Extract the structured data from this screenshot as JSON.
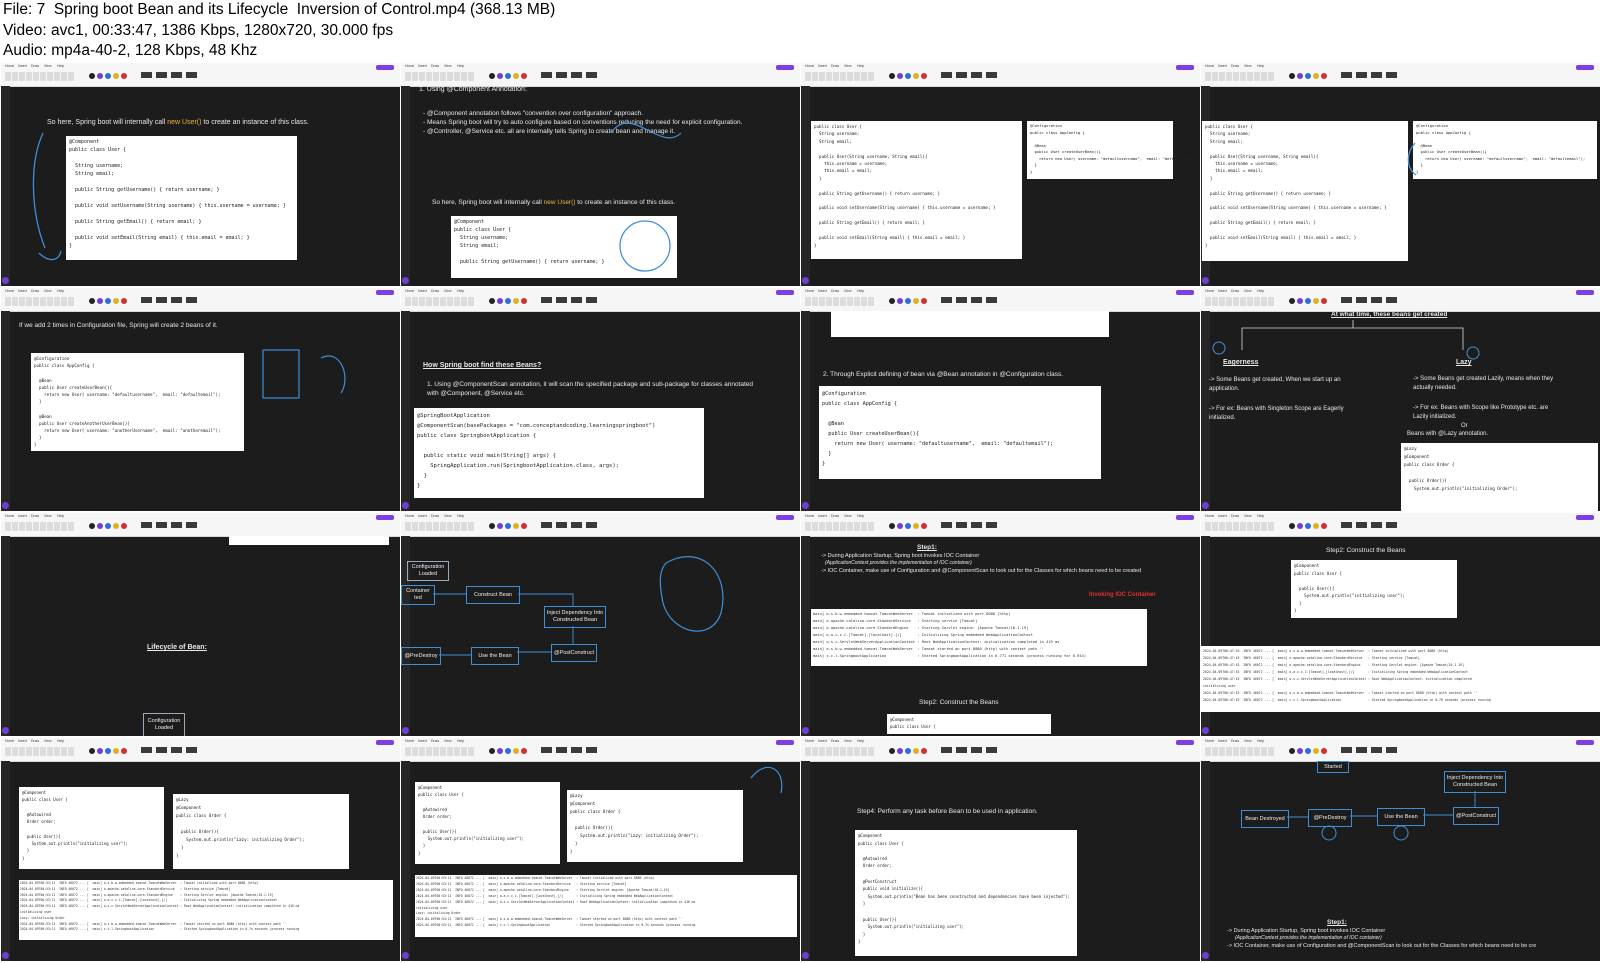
{
  "header": {
    "file_line": "File: 7  Spring boot Bean and its Lifecycle  Inversion of Control.mp4 (368.13 MB)",
    "video_line": "Video: avc1, 00:33:47, 1386 Kbps, 1280x720, 30.000 fps",
    "audio_line": "Audio: mp4a-40-2, 128 Kbps, 48 Khz"
  },
  "toolbar": {
    "menus": [
      "Home",
      "Insert",
      "Draw",
      "View",
      "Help"
    ],
    "share": "Share"
  },
  "colors": {
    "accent": "#7b3fe4",
    "ink": "#3f8fd8",
    "annotation": "#f0b341",
    "background": "#1c1c1c"
  },
  "frames": {
    "f1": {
      "text_pre": "So here, Spring boot will internally call ",
      "text_hl": "new User()",
      "text_post": " to create an instance of this class.",
      "code": [
        "@Component",
        "public class User {",
        "",
        "  String username;",
        "  String email;",
        "",
        "  public String getUsername() { return username; }",
        "",
        "  public void setUsername(String username) { this.username = username; }",
        "",
        "  public String getEmail() { return email; }",
        "",
        "  public void setEmail(String email) { this.email = email; }",
        "}"
      ]
    },
    "f2": {
      "heading": "1.  Using @Component Annotation:",
      "bullets": [
        "@Component annotation follows \"convention over configuration\" approach.",
        "Means Spring boot will try to auto configure based on conventions reducing the need for explicit configuration.",
        "@Controller, @Service etc. all are internally tells Spring to create bean and manage it."
      ],
      "text_pre": "So here, Spring boot will internally call ",
      "text_hl": "new User()",
      "text_post": " to create an instance of this class.",
      "code": [
        "@Component",
        "public class User {",
        "  String username;",
        "  String email;",
        "",
        "  public String getUsername() { return username; }"
      ]
    },
    "f3": {
      "code_left": [
        "public class User {",
        "  String username;",
        "  String email;",
        "",
        "  public User(String username, String email){",
        "    this.username = username;",
        "    this.email = email;",
        "  }",
        "",
        "  public String getUsername() { return username; }",
        "",
        "  public void setUsername(String username) { this.username = username; }",
        "",
        "  public String getEmail() { return email; }",
        "",
        "  public void setEmail(String email) { this.email = email; }",
        "}"
      ],
      "code_right": [
        "@Configuration",
        "public class AppConfig {",
        "",
        "  @Bean",
        "  public User createUserBean(){",
        "    return new User( username: \"defaultusername\",  email: \"defaultemail\");",
        "  }",
        "}"
      ]
    },
    "f4": {
      "code_left": [
        "public class User {",
        "  String username;",
        "  String email;",
        "",
        "  public User(String username, String email){",
        "    this.username = username;",
        "    this.email = email;",
        "  }",
        "",
        "  public String getUsername() { return username; }",
        "",
        "  public void setUsername(String username) { this.username = username; }",
        "",
        "  public String getEmail() { return email; }",
        "",
        "  public void setEmail(String email) { this.email = email; }",
        "}"
      ],
      "code_right": [
        "@Configuration",
        "public class AppConfig {",
        "",
        "  @Bean",
        "  public User createUserBean(){",
        "    return new User( username: \"defaultusername\",  email: \"defaultemail\");",
        "  }",
        "}"
      ]
    },
    "f5": {
      "text": "If we add 2 times in Configuration file, Spring will create 2 beans of it.",
      "code": [
        "@Configuration",
        "public class AppConfig {",
        "",
        "  @Bean",
        "  public User createUserBean(){",
        "    return new User( username: \"defaultusername\",  email: \"defaultemail\");",
        "  }",
        "",
        "  @Bean",
        "  public User createAnotherUserBean(){",
        "    return new User( username: \"anotherUsername\",  email: \"anotheremail\");",
        "  }",
        "}"
      ]
    },
    "f6": {
      "heading": "How Spring boot find these Beans?",
      "item": "1.  Using @ComponentScan annotation, it will scan the specified package and sub-package for classes annotated with @Component, @Service etc.",
      "code": [
        "@SpringBootApplication",
        "@ComponentScan(basePackages = \"com.conceptandcoding.learningspringboot\")",
        "public class SpringbootApplication {",
        "",
        "  public static void main(String[] args) {",
        "    SpringApplication.run(SpringbootApplication.class, args);",
        "  }",
        "}"
      ]
    },
    "f7": {
      "item": "2.  Through Explicit defining of bean via @Bean annotation in @Configuration class.",
      "code": [
        "@Configuration",
        "public class AppConfig {",
        "",
        "  @Bean",
        "  public User createUserBean(){",
        "    return new User( username: \"defaultusername\",  email: \"defaultemail\");",
        "  }",
        "}"
      ]
    },
    "f8": {
      "heading": "At what time, these beans get created",
      "left_title": "Eagerness",
      "left_l1": "-> Some Beans get created, When we start up an application.",
      "left_l2": "-> For ex: Beans with Singleton Scope are Eagerly initialized.",
      "right_title": "Lazy",
      "right_l1": "-> Some Beans get created Lazily, means when they actually needed.",
      "right_l2": "-> For ex: Beans with Scope like Prototype etc. are Lazily initialized.",
      "right_or": "Or",
      "right_l3": "Beans with @Lazy annotation.",
      "code": [
        "@Lazy",
        "@Component",
        "public class Order {",
        "",
        "  public Order(){",
        "    System.out.println(\"initializing Order\");"
      ]
    },
    "f9": {
      "title": "Lifecycle of  Bean:",
      "box": "Configuration Loaded"
    },
    "f10": {
      "boxes": [
        "Configuration Loaded",
        "Container ted",
        "Construct Bean",
        "Inject Dependency Into Constructed Bean",
        "@PostConstruct",
        "Use the Bean",
        "@PreDestroy"
      ]
    },
    "f11": {
      "step1": "Step1:",
      "l1": "-> During Application Startup, Spring boot invokes IOC Container",
      "l2": "(ApplicationContext provides the implementation of IOC container)",
      "l3": "-> IOC Container, make use of Configuration and @ComponentScan to look out for the Classes for which beans need to be created",
      "annotation": "Invoking IOC Container",
      "log": [
        "main] o.s.b.w.embedded.tomcat.TomcatWebServer  : Tomcat initialized with port 8080 (http)",
        "main] o.apache.catalina.core.StandardService   : Starting service [Tomcat]",
        "main] o.apache.catalina.core.StandardEngine    : Starting Servlet engine: [Apache Tomcat/10.1.19]",
        "main] o.a.c.c.C.[Tomcat].[localhost].[/]       : Initializing Spring embedded WebApplicationContext",
        "main] w.s.c.ServletWebServerApplicationContext : Root WebApplicationContext: initialization completed in 419 ms",
        "main] o.s.b.w.embedded.tomcat.TomcatWebServer  : Tomcat started on port 8080 (http) with context path ''",
        "main] c.c.l.SpringbootApplication              : Started SpringbootApplication in 0.771 seconds (process running for 0.944)"
      ],
      "step2": "Step2:  Construct the Beans",
      "code": [
        "@Component",
        "public class User {"
      ]
    },
    "f12": {
      "step2": "Step2:  Construct the Beans",
      "code": [
        "@Component",
        "public class User {",
        "",
        "  public User(){",
        "    System.out.println(\"initializing user\");",
        "  }",
        "}"
      ],
      "log": [
        "2024-04-09T00:47:43  INFO 46072 --- [  main] o.s.b.w.embedded.tomcat.TomcatWebServer  : Tomcat initialized with port 8080 (http)",
        "2024-04-09T00:47:43  INFO 46072 --- [  main] o.apache.catalina.core.StandardService   : Starting service [Tomcat]",
        "2024-04-09T00:47:43  INFO 46072 --- [  main] o.apache.catalina.core.StandardEngine    : Starting Servlet engine: [Apache Tomcat/10.1.19]",
        "2024-04-09T00:47:43  INFO 46072 --- [  main] o.a.c.c.C.[Tomcat].[localhost].[/]       : Initializing Spring embedded WebApplicationContext",
        "2024-04-09T00:47:43  INFO 46072 --- [  main] w.s.c.ServletWebServerApplicationContext : Root WebApplicationContext: initialization completed",
        "initializing user",
        "2024-04-09T00:47:43  INFO 46072 --- [  main] o.s.b.w.embedded.tomcat.TomcatWebServer  : Tomcat started on port 8080 (http) with context path ''",
        "2024-04-09T00:47:43  INFO 46072 --- [  main] c.c.l.SpringbootApplication              : Started SpringbootApplication in 0.78 seconds (process running"
      ]
    },
    "f13": {
      "code_left": [
        "@Component",
        "public class User {",
        "",
        "  @Autowired",
        "  Order order;",
        "",
        "  public User(){",
        "    System.out.println(\"initializing user\");",
        "  }",
        "}"
      ],
      "code_right": [
        "@Lazy",
        "@Component",
        "public class Order {",
        "",
        "  public Order(){",
        "    System.out.println(\"Lazy: initializing Order\");",
        "  }",
        "}"
      ],
      "log": [
        "2024-04-09T00:53:11  INFO 46072 --- [  main] o.s.b.w.embedded.tomcat.TomcatWebServer  : Tomcat initialized with port 8080 (http)",
        "2024-04-09T00:53:11  INFO 46072 --- [  main] o.apache.catalina.core.StandardService   : Starting service [Tomcat]",
        "2024-04-09T00:53:11  INFO 46072 --- [  main] o.apache.catalina.core.StandardEngine    : Starting Servlet engine: [Apache Tomcat/10.1.19]",
        "2024-04-09T00:53:11  INFO 46072 --- [  main] o.a.c.c.C.[Tomcat].[localhost].[/]       : Initializing Spring embedded WebApplicationContext",
        "2024-04-09T00:53:11  INFO 46072 --- [  main] w.s.c.ServletWebServerApplicationContext : Root WebApplicationContext: initialization completed in 416 ms",
        "initializing user",
        "Lazy: initializing Order",
        "2024-04-09T00:53:11  INFO 46072 --- [  main] o.s.b.w.embedded.tomcat.TomcatWebServer  : Tomcat started on port 8080 (http) with context path ''",
        "2024-04-09T00:53:11  INFO 46072 --- [  main] c.c.l.SpringbootApplication              : Started SpringbootApplication in 0.7s seconds (process running"
      ]
    },
    "f14": {
      "code_left": [
        "@Component",
        "public class User {",
        "",
        "  @Autowired",
        "  Order order;",
        "",
        "  public User(){",
        "    System.out.println(\"initializing user\");",
        "  }",
        "}"
      ],
      "code_right": [
        "@Lazy",
        "@Component",
        "public class Order {",
        "",
        "  public Order(){",
        "    System.out.println(\"Lazy: initializing Order\");",
        "  }",
        "}"
      ],
      "log": [
        "2024-04-09T00:53:11  INFO 46072 --- [  main] o.s.b.w.embedded.tomcat.TomcatWebServer  : Tomcat initialized with port 8080 (http)",
        "2024-04-09T00:53:11  INFO 46072 --- [  main] o.apache.catalina.core.StandardService   : Starting service [Tomcat]",
        "2024-04-09T00:53:11  INFO 46072 --- [  main] o.apache.catalina.core.StandardEngine    : Starting Servlet engine: [Apache Tomcat/10.1.19]",
        "2024-04-09T00:53:11  INFO 46072 --- [  main] o.a.c.c.C.[Tomcat].[localhost].[/]       : Initializing Spring embedded WebApplicationContext",
        "2024-04-09T00:53:11  INFO 46072 --- [  main] w.s.c.ServletWebServerApplicationContext : Root WebApplicationContext: initialization completed in 416 ms",
        "initializing user",
        "Lazy: initializing Order",
        "2024-04-09T00:53:11  INFO 46072 --- [  main] o.s.b.w.embedded.tomcat.TomcatWebServer  : Tomcat started on port 8080 (http) with context path ''",
        "2024-04-09T00:53:11  INFO 46072 --- [  main] c.c.l.SpringbootApplication              : Started SpringbootApplication in 0.7s seconds (process running"
      ]
    },
    "f15": {
      "step4": "Step4: Perform any task before Bean to be used in application.",
      "code": [
        "@Component",
        "public class User {",
        "",
        "  @Autowired",
        "  Order order;",
        "",
        "  @PostConstruct",
        "  public void initialize(){",
        "    System.out.println(\"Bean has been constructed and dependencies have been injected\");",
        "  }",
        "",
        "  public User(){",
        "    System.out.println(\"initializing user\");",
        "  }",
        "}"
      ]
    },
    "f16": {
      "boxes": [
        "Started",
        "Inject Dependency Into Constructed Bean",
        "Bean Destroyed",
        "@PreDestroy",
        "Use the Bean",
        "@PostConstruct"
      ],
      "step1": "Step1:",
      "l1": "-> During Application Startup, Spring boot invokes IOC Container",
      "l2": "(ApplicationContext provides the implementation of IOC container)",
      "l3": "-> IOC Container, make use of Configuration and @ComponentScan to look out for the Classes for which beans need to be cre"
    }
  }
}
